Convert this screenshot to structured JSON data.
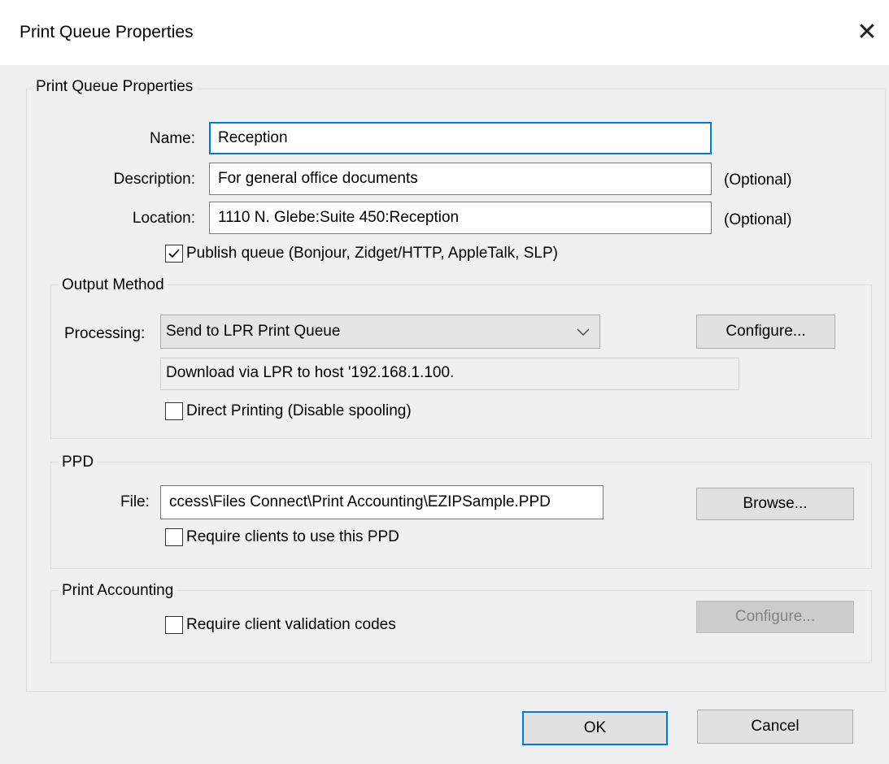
{
  "window": {
    "title": "Print Queue Properties",
    "close_glyph": "✕"
  },
  "main_group": {
    "title": "Print Queue Properties",
    "name_label": "Name:",
    "name_value": "Reception",
    "description_label": "Description:",
    "description_value": "For general office documents",
    "description_hint": "(Optional)",
    "location_label": "Location:",
    "location_value": "1110 N. Glebe:Suite 450:Reception",
    "location_hint": "(Optional)",
    "publish_label": "Publish queue (Bonjour, Zidget/HTTP, AppleTalk, SLP)",
    "publish_checked": true
  },
  "output_method": {
    "title": "Output Method",
    "processing_label": "Processing:",
    "processing_value": "Send to LPR Print Queue",
    "configure_label": "Configure...",
    "info_text": "Download via LPR to host '192.168.1.100.",
    "direct_printing_label": "Direct Printing (Disable spooling)",
    "direct_printing_checked": false
  },
  "ppd": {
    "title": "PPD",
    "file_label": "File:",
    "file_value": "ccess\\Files Connect\\Print Accounting\\EZIPSample.PPD",
    "browse_label": "Browse...",
    "require_label": "Require clients to use this PPD",
    "require_checked": false
  },
  "print_accounting": {
    "title": "Print Accounting",
    "require_codes_label": "Require client validation codes",
    "require_codes_checked": false,
    "configure_label": "Configure..."
  },
  "footer": {
    "ok_label": "OK",
    "cancel_label": "Cancel"
  },
  "icons": {
    "close": "close-icon",
    "chevron": "chevron-down-icon",
    "check": "checkmark-icon"
  },
  "colors": {
    "accent": "#0078d7",
    "dialog_bg": "#f0f0f0",
    "button_bg": "#e1e1e1"
  }
}
